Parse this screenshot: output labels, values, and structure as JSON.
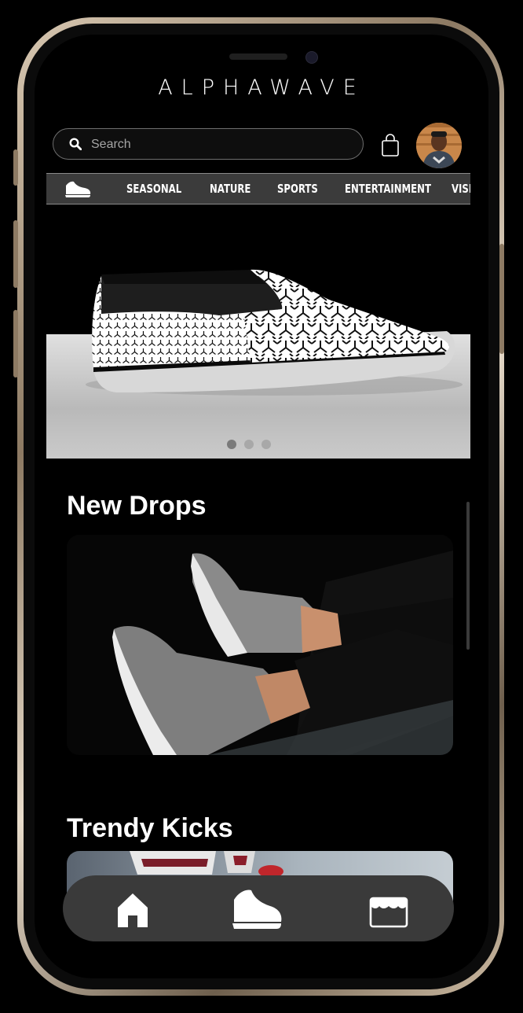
{
  "app": {
    "brand": "ALPHAWAVE"
  },
  "header": {
    "search_placeholder": "Search",
    "search_value": ""
  },
  "icons": {
    "search": "search-icon",
    "bag": "shopping-bag-icon",
    "avatar": "user-avatar",
    "nav_home": "shoe-icon",
    "tab_home": "home-icon",
    "tab_shoes": "shoe-icon",
    "tab_store": "store-icon"
  },
  "nav": {
    "items": [
      {
        "label": "SEASONAL"
      },
      {
        "label": "NATURE"
      },
      {
        "label": "SPORTS"
      },
      {
        "label": "ENTERTAINMENT"
      },
      {
        "label": "VISI"
      }
    ]
  },
  "carousel": {
    "slides": 3,
    "active_index": 0
  },
  "sections": {
    "new_drops": {
      "title": "New Drops"
    },
    "trendy_kicks": {
      "title": "Trendy Kicks"
    }
  },
  "colors": {
    "background": "#000000",
    "tab_bar": "#3a3a3a",
    "nav_bar": "#3b3b3b",
    "text": "#ffffff"
  }
}
